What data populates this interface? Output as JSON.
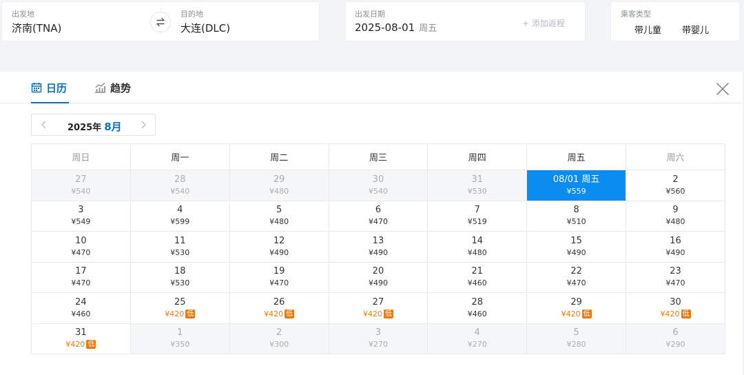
{
  "search": {
    "origin_label": "出发地",
    "origin_value": "济南(TNA)",
    "dest_label": "目的地",
    "dest_value": "大连(DLC)",
    "date_label": "出发日期",
    "date_value": "2025-08-01",
    "date_weekday": "周五",
    "add_return": "+ 添加返程",
    "pax_label": "乘客类型",
    "pax_child": "带儿童",
    "pax_infant": "带婴儿"
  },
  "tabs": {
    "calendar": "日历",
    "trend": "趋势"
  },
  "month_nav": {
    "year": "2025年",
    "month": "8月"
  },
  "weekdays": [
    "周日",
    "周一",
    "周二",
    "周三",
    "周四",
    "周五",
    "周六"
  ],
  "low_badge": "低",
  "colors": {
    "accent": "#0a6ec8",
    "selected": "#0a8cf0",
    "low": "#f0780a"
  },
  "calendar": [
    [
      {
        "day": "27",
        "price": "¥540",
        "state": "other"
      },
      {
        "day": "28",
        "price": "¥540",
        "state": "other"
      },
      {
        "day": "29",
        "price": "¥480",
        "state": "other"
      },
      {
        "day": "30",
        "price": "¥540",
        "state": "other"
      },
      {
        "day": "31",
        "price": "¥530",
        "state": "other"
      },
      {
        "day": "08/01 周五",
        "price": "¥559",
        "state": "selected"
      },
      {
        "day": "2",
        "price": "¥560",
        "state": "normal"
      }
    ],
    [
      {
        "day": "3",
        "price": "¥549",
        "state": "normal"
      },
      {
        "day": "4",
        "price": "¥599",
        "state": "normal"
      },
      {
        "day": "5",
        "price": "¥480",
        "state": "normal"
      },
      {
        "day": "6",
        "price": "¥470",
        "state": "normal"
      },
      {
        "day": "7",
        "price": "¥519",
        "state": "normal"
      },
      {
        "day": "8",
        "price": "¥510",
        "state": "normal"
      },
      {
        "day": "9",
        "price": "¥480",
        "state": "normal"
      }
    ],
    [
      {
        "day": "10",
        "price": "¥470",
        "state": "normal"
      },
      {
        "day": "11",
        "price": "¥530",
        "state": "normal"
      },
      {
        "day": "12",
        "price": "¥490",
        "state": "normal"
      },
      {
        "day": "13",
        "price": "¥490",
        "state": "normal"
      },
      {
        "day": "14",
        "price": "¥480",
        "state": "normal"
      },
      {
        "day": "15",
        "price": "¥490",
        "state": "normal"
      },
      {
        "day": "16",
        "price": "¥490",
        "state": "normal"
      }
    ],
    [
      {
        "day": "17",
        "price": "¥470",
        "state": "normal"
      },
      {
        "day": "18",
        "price": "¥530",
        "state": "normal"
      },
      {
        "day": "19",
        "price": "¥470",
        "state": "normal"
      },
      {
        "day": "20",
        "price": "¥490",
        "state": "normal"
      },
      {
        "day": "21",
        "price": "¥460",
        "state": "normal"
      },
      {
        "day": "22",
        "price": "¥470",
        "state": "normal"
      },
      {
        "day": "23",
        "price": "¥470",
        "state": "normal"
      }
    ],
    [
      {
        "day": "24",
        "price": "¥460",
        "state": "normal"
      },
      {
        "day": "25",
        "price": "¥420",
        "state": "low"
      },
      {
        "day": "26",
        "price": "¥420",
        "state": "low"
      },
      {
        "day": "27",
        "price": "¥420",
        "state": "low"
      },
      {
        "day": "28",
        "price": "¥460",
        "state": "normal"
      },
      {
        "day": "29",
        "price": "¥420",
        "state": "low"
      },
      {
        "day": "30",
        "price": "¥420",
        "state": "low"
      }
    ],
    [
      {
        "day": "31",
        "price": "¥420",
        "state": "low"
      },
      {
        "day": "1",
        "price": "¥350",
        "state": "other"
      },
      {
        "day": "2",
        "price": "¥300",
        "state": "other"
      },
      {
        "day": "3",
        "price": "¥270",
        "state": "other"
      },
      {
        "day": "4",
        "price": "¥270",
        "state": "other"
      },
      {
        "day": "5",
        "price": "¥280",
        "state": "other"
      },
      {
        "day": "6",
        "price": "¥290",
        "state": "other"
      }
    ]
  ]
}
